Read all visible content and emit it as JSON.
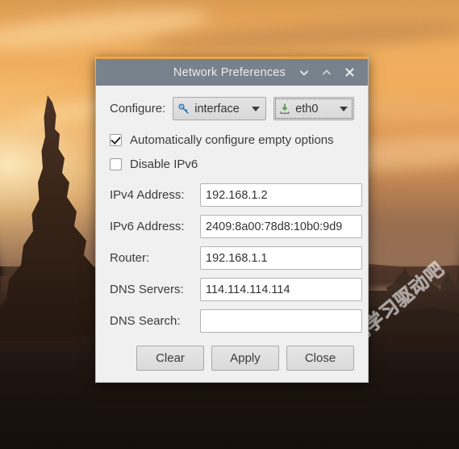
{
  "window": {
    "title": "Network Preferences",
    "titlebar_color": "#78828c",
    "accent_color": "#f0a346",
    "buttons": [
      {
        "name": "shade-button",
        "glyph": "chevron-down"
      },
      {
        "name": "unshade-button",
        "glyph": "chevron-up"
      },
      {
        "name": "close-button",
        "glyph": "close-x"
      }
    ]
  },
  "configure": {
    "label": "Configure:",
    "method": {
      "value": "interface",
      "icon": "key-icon"
    },
    "device": {
      "value": "eth0",
      "icon": "download-arrow-icon",
      "focused": true
    }
  },
  "options": [
    {
      "label": "Automatically configure empty options",
      "checked": true
    },
    {
      "label": "Disable IPv6",
      "checked": false
    }
  ],
  "fields": [
    {
      "label": "IPv4 Address:",
      "value": "192.168.1.2",
      "placeholder": ""
    },
    {
      "label": "IPv6 Address:",
      "value": "2409:8a00:78d8:10b0:9d9",
      "placeholder": ""
    },
    {
      "label": "Router:",
      "value": "192.168.1.1",
      "placeholder": ""
    },
    {
      "label": "DNS Servers:",
      "value": "114.114.114.114",
      "placeholder": ""
    },
    {
      "label": "DNS Search:",
      "value": "",
      "placeholder": ""
    }
  ],
  "actions": [
    {
      "label": "Clear",
      "name": "clear-button"
    },
    {
      "label": "Apply",
      "name": "apply-button"
    },
    {
      "label": "Close",
      "name": "close-dialog-button"
    }
  ],
  "watermark": {
    "text": "互动吧学习驱动吧"
  }
}
